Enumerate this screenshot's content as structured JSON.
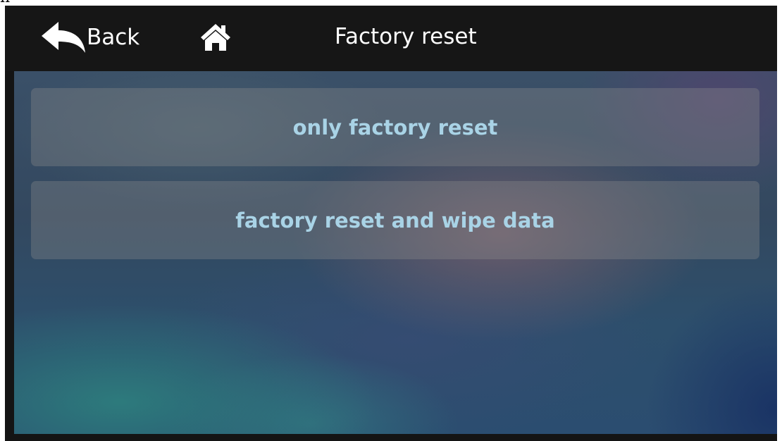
{
  "caption": {
    "partial_text": "n"
  },
  "header": {
    "back_label": "Back",
    "back_icon": "back-arrow-icon",
    "home_icon": "home-icon",
    "title": "Factory reset"
  },
  "options": [
    {
      "label": "only factory reset"
    },
    {
      "label": "factory reset and wipe data"
    }
  ],
  "colors": {
    "header_bg": "#161616",
    "header_text": "#ffffff",
    "option_text": "#a9d3e6",
    "option_bg": "rgba(140,140,140,0.35)"
  }
}
